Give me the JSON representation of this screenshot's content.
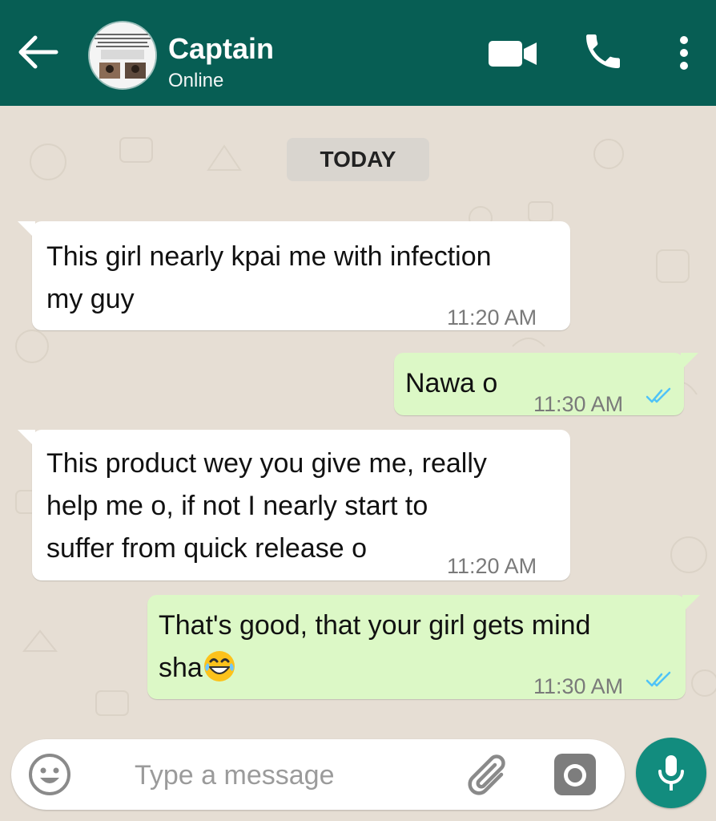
{
  "header": {
    "contact_name": "Captain",
    "status": "Online"
  },
  "chat": {
    "date_chip": "TODAY",
    "messages": [
      {
        "direction": "incoming",
        "text": "This girl nearly kpai me with infection\nmy guy",
        "time": "11:20 AM"
      },
      {
        "direction": "outgoing",
        "text": "Nawa o",
        "time": "11:30 AM",
        "read": true
      },
      {
        "direction": "incoming",
        "text": "This product wey you give me, really\nhelp me o, if not I nearly start to\nsuffer from quick release o",
        "time": "11:20 AM"
      },
      {
        "direction": "outgoing",
        "text": "That's good, that your girl gets mind\nsha",
        "emoji": "face-with-tears-of-joy",
        "time": "11:30 AM",
        "read": true
      }
    ]
  },
  "composer": {
    "placeholder": "Type a message"
  },
  "icons": [
    "back-arrow-icon",
    "video-call-icon",
    "phone-icon",
    "more-vert-icon",
    "emoji-icon",
    "attach-icon",
    "camera-icon",
    "mic-icon"
  ],
  "colors": {
    "header": "#075e54",
    "outgoing_bubble": "#dcf8c6",
    "incoming_bubble": "#ffffff",
    "chat_background": "#e6ded4",
    "mic_button": "#128c7e",
    "read_ticks": "#4fc3f7"
  }
}
